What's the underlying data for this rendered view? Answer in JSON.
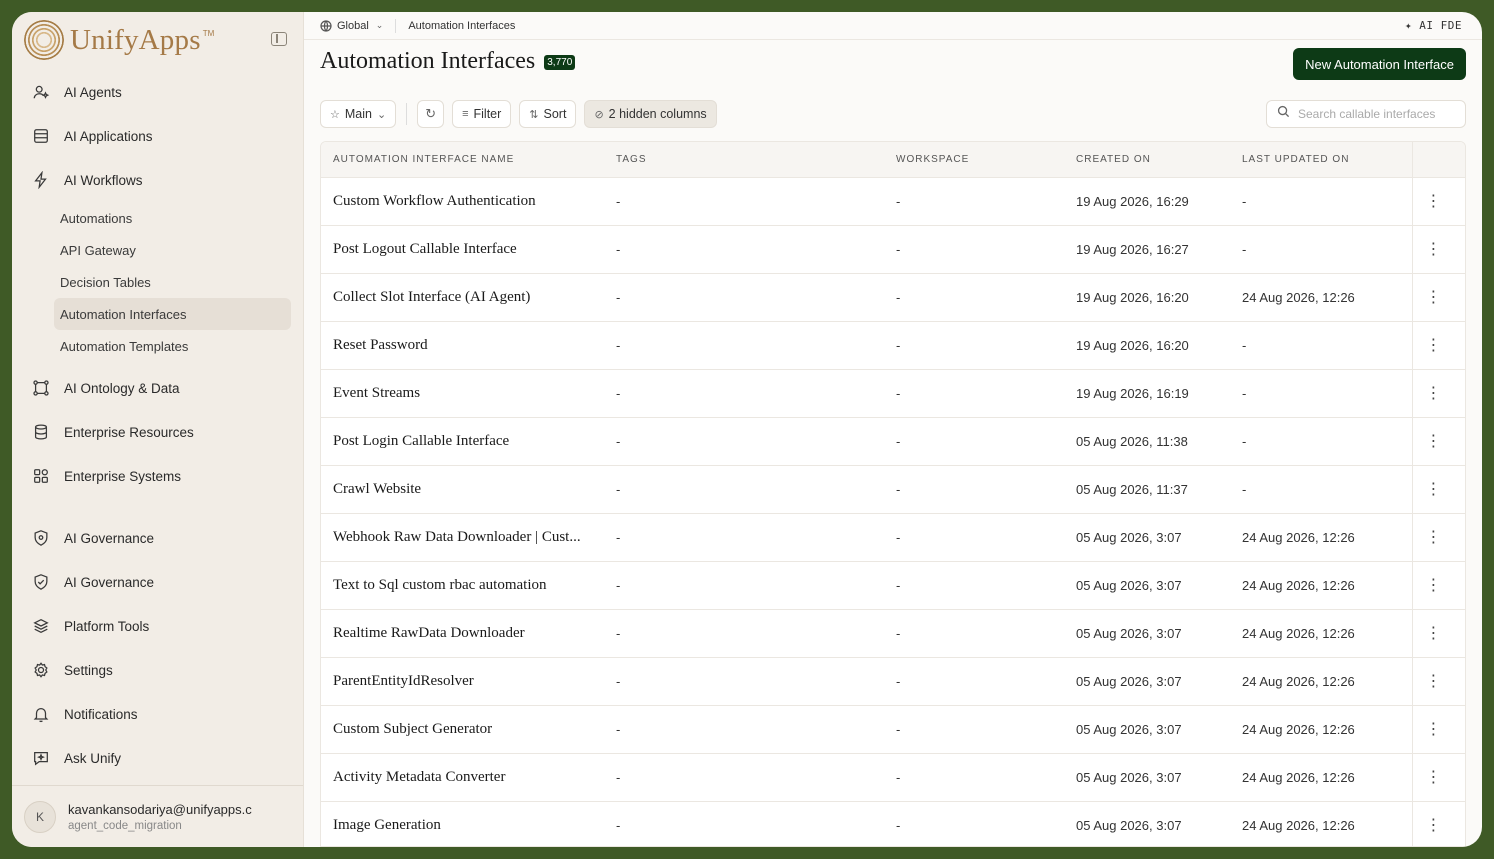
{
  "sidebar": {
    "brand": "UnifyApps",
    "brand_tm": "TM",
    "items": [
      {
        "label": "AI Agents"
      },
      {
        "label": "AI Applications"
      },
      {
        "label": "AI Workflows"
      }
    ],
    "subitems": [
      {
        "label": "Automations"
      },
      {
        "label": "API Gateway"
      },
      {
        "label": "Decision Tables"
      },
      {
        "label": "Automation Interfaces"
      },
      {
        "label": "Automation Templates"
      }
    ],
    "items2": [
      {
        "label": "AI Ontology & Data"
      },
      {
        "label": "Enterprise Resources"
      },
      {
        "label": "Enterprise Systems"
      }
    ],
    "items3": [
      {
        "label": "AI Governance"
      },
      {
        "label": "AI Governance"
      },
      {
        "label": "Platform Tools"
      },
      {
        "label": "Settings"
      },
      {
        "label": "Notifications"
      },
      {
        "label": "Ask Unify"
      }
    ],
    "user": {
      "initial": "K",
      "email": "kavankansodariya@unifyapps.c",
      "org": "agent_code_migration"
    }
  },
  "topbar": {
    "scope": "Global",
    "crumb": "Automation Interfaces",
    "ai_label": "AI FDE"
  },
  "page": {
    "title": "Automation Interfaces",
    "count": "3,770",
    "new_button": "New Automation Interface"
  },
  "toolbar": {
    "view": "Main",
    "filter": "Filter",
    "sort": "Sort",
    "hidden": "2 hidden columns",
    "search_placeholder": "Search callable interfaces"
  },
  "table": {
    "headers": [
      "AUTOMATION INTERFACE NAME",
      "TAGS",
      "WORKSPACE",
      "CREATED ON",
      "LAST UPDATED ON"
    ],
    "rows": [
      [
        "Custom Workflow Authentication",
        "-",
        "-",
        "19 Aug 2026, 16:29",
        "-"
      ],
      [
        "Post Logout Callable Interface",
        "-",
        "-",
        "19 Aug 2026, 16:27",
        "-"
      ],
      [
        "Collect Slot Interface (AI Agent)",
        "-",
        "-",
        "19 Aug 2026, 16:20",
        "24 Aug 2026, 12:26"
      ],
      [
        "Reset Password",
        "-",
        "-",
        "19 Aug 2026, 16:20",
        "-"
      ],
      [
        "Event Streams",
        "-",
        "-",
        "19 Aug 2026, 16:19",
        "-"
      ],
      [
        "Post Login Callable Interface",
        "-",
        "-",
        "05 Aug 2026, 11:38",
        "-"
      ],
      [
        "Crawl Website",
        "-",
        "-",
        "05 Aug 2026, 11:37",
        "-"
      ],
      [
        "Webhook Raw Data Downloader | Cust...",
        "-",
        "-",
        "05 Aug 2026, 3:07",
        "24 Aug 2026, 12:26"
      ],
      [
        "Text to Sql custom rbac automation",
        "-",
        "-",
        "05 Aug 2026, 3:07",
        "24 Aug 2026, 12:26"
      ],
      [
        "Realtime RawData Downloader",
        "-",
        "-",
        "05 Aug 2026, 3:07",
        "24 Aug 2026, 12:26"
      ],
      [
        "ParentEntityIdResolver",
        "-",
        "-",
        "05 Aug 2026, 3:07",
        "24 Aug 2026, 12:26"
      ],
      [
        "Custom Subject Generator",
        "-",
        "-",
        "05 Aug 2026, 3:07",
        "24 Aug 2026, 12:26"
      ],
      [
        "Activity Metadata Converter",
        "-",
        "-",
        "05 Aug 2026, 3:07",
        "24 Aug 2026, 12:26"
      ],
      [
        "Image Generation",
        "-",
        "-",
        "05 Aug 2026, 3:07",
        "24 Aug 2026, 12:26"
      ]
    ]
  },
  "colors": {
    "accent": "#0d3a16",
    "sidebar_bg": "#f2ede6",
    "frame_bg": "#3f5a26",
    "brand": "#a57a47"
  }
}
